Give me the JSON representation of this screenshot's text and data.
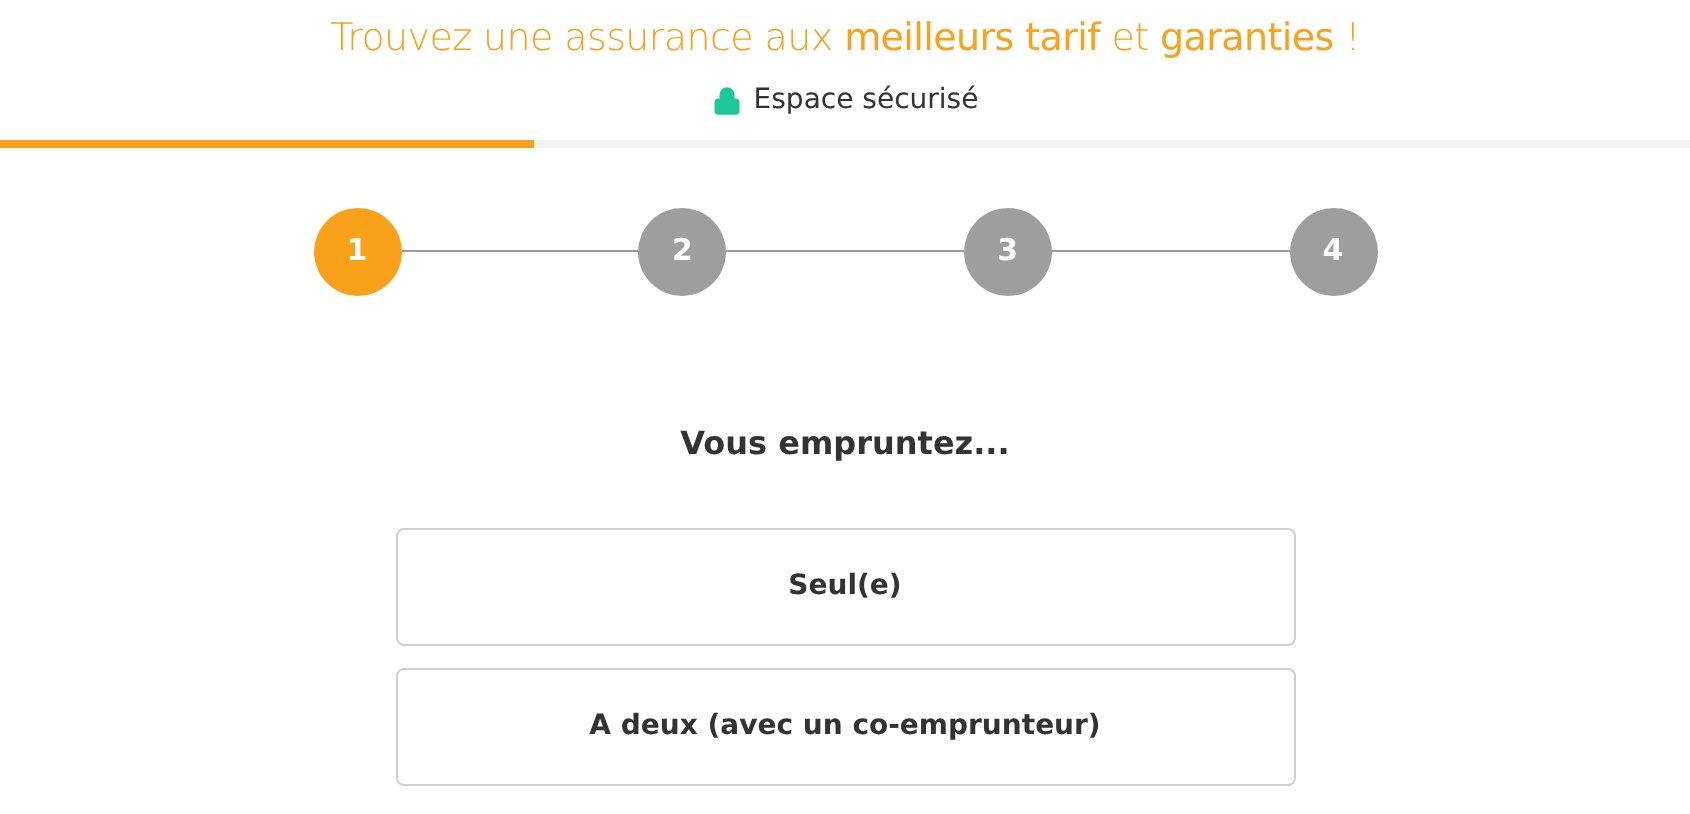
{
  "header": {
    "title": "Trouvez une assurance aux **meilleurs tarif** et **garanties** !",
    "secure_label": "Espace sécurisé"
  },
  "progress": {
    "level": 0.316
  },
  "steps": [
    {
      "label": "1",
      "selected": true
    },
    {
      "label": "2",
      "selected": false
    },
    {
      "label": "3",
      "selected": false
    },
    {
      "label": "4",
      "selected": false
    }
  ],
  "question": "Vous empruntez...",
  "options": [
    {
      "label": "Seul(e)",
      "selected": false
    },
    {
      "label": "A deux (avec un co-emprunteur)",
      "selected": false
    }
  ]
}
